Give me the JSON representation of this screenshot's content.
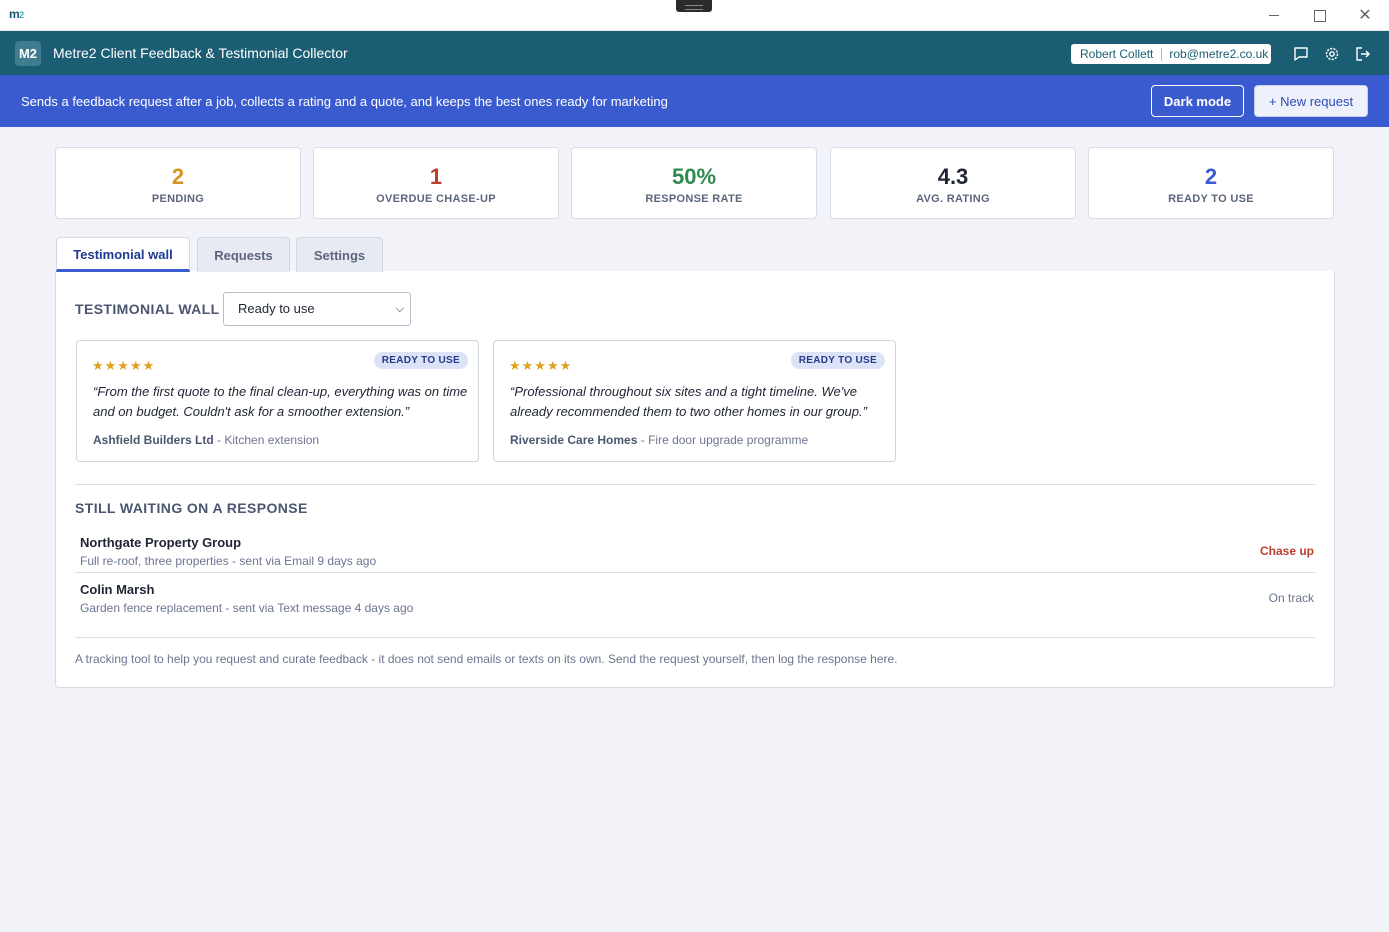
{
  "window": {
    "logo": "m",
    "logo_sub": "2",
    "close_glyph": "✕"
  },
  "header": {
    "badge": "M2",
    "title": "Metre2 Client Feedback & Testimonial Collector",
    "user_name": "Robert Collett",
    "user_email": "rob@metre2.co.uk"
  },
  "banner": {
    "description": "Sends a feedback request after a job, collects a rating and a quote, and keeps the best ones ready for marketing",
    "dark_mode_label": "Dark mode",
    "new_request_label": "+ New request"
  },
  "stats": [
    {
      "value": "2",
      "label": "PENDING",
      "color": "#d4951c"
    },
    {
      "value": "1",
      "label": "OVERDUE CHASE-UP",
      "color": "#b8402d"
    },
    {
      "value": "50%",
      "label": "RESPONSE RATE",
      "color": "#2e8a4e"
    },
    {
      "value": "4.3",
      "label": "AVG. RATING",
      "color": "#1e2433"
    },
    {
      "value": "2",
      "label": "READY TO USE",
      "color": "#3a5bcf"
    }
  ],
  "tabs": [
    {
      "label": "Testimonial wall"
    },
    {
      "label": "Requests"
    },
    {
      "label": "Settings"
    }
  ],
  "wall": {
    "title": "TESTIMONIAL WALL",
    "filter_value": "Ready to use",
    "cards": [
      {
        "stars": "★★★★★",
        "tag": "READY TO USE",
        "quote": "“From the first quote to the final clean-up, everything was on time and on budget. Couldn't ask for a smoother extension.”",
        "client": "Ashfield Builders Ltd",
        "job": " - Kitchen extension"
      },
      {
        "stars": "★★★★★",
        "tag": "READY TO USE",
        "quote": "“Professional throughout six sites and a tight timeline. We've already recommended them to two other homes in our group.”",
        "client": "Riverside Care Homes",
        "job": " - Fire door upgrade programme"
      }
    ]
  },
  "waiting": {
    "title": "STILL WAITING ON A RESPONSE",
    "rows": [
      {
        "name": "Northgate Property Group",
        "meta": "Full re-roof, three properties - sent via Email 9 days ago",
        "status": "Chase up",
        "status_color": "#b8402d"
      },
      {
        "name": "Colin Marsh",
        "meta": "Garden fence replacement - sent via Text message 4 days ago",
        "status": "On track",
        "status_color": "#6b7590"
      }
    ]
  },
  "footnote": "A tracking tool to help you request and curate feedback - it does not send emails or texts on its own. Send the request yourself, then log the response here."
}
